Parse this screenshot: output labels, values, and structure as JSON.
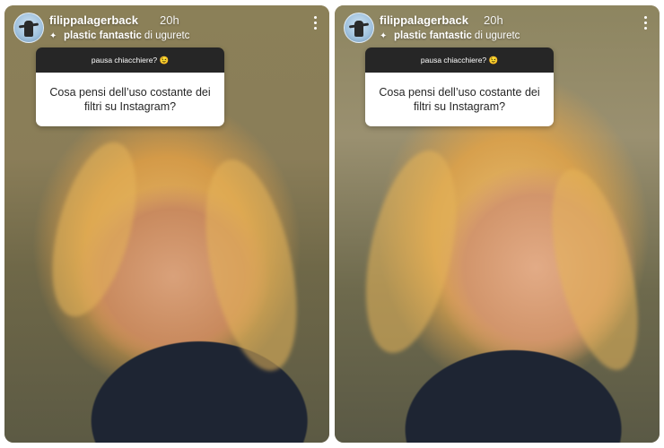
{
  "stories": [
    {
      "username": "filippalagerback",
      "time": "20h",
      "effect": {
        "name": "plastic fantastic",
        "by": "di uguretc"
      },
      "question": {
        "header": "pausa chiacchiere? 😉",
        "text": "Cosa pensi dell’uso costante dei filtri su Instagram?"
      }
    },
    {
      "username": "filippalagerback",
      "time": "20h",
      "effect": {
        "name": "plastic fantastic",
        "by": "di uguretc"
      },
      "question": {
        "header": "pausa chiacchiere? 😉",
        "text": "Cosa pensi dell’uso costante dei filtri su Instagram?"
      }
    }
  ],
  "icons": {
    "effect": "sparkle-icon",
    "menu": "more-vertical-icon",
    "avatar": "profile-avatar"
  }
}
